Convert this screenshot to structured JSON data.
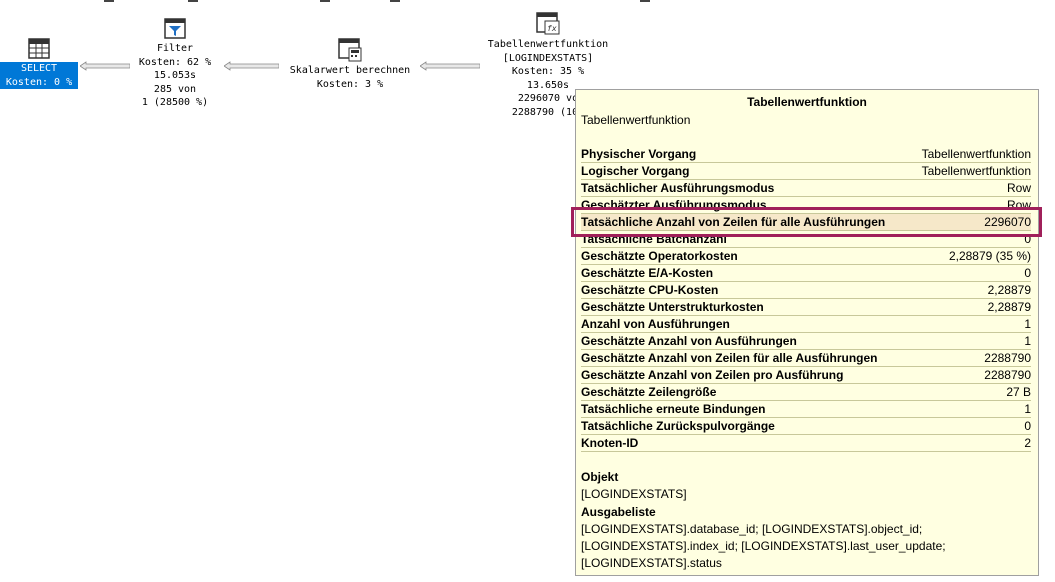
{
  "nodes": {
    "select": {
      "label": "SELECT",
      "cost": "Kosten: 0 %"
    },
    "filter": {
      "title": "Filter",
      "cost": "Kosten: 62 %",
      "time": "15.053s",
      "rows": "285 von",
      "est": "1 (28500 %)"
    },
    "scalar": {
      "title": "Skalarwert berechnen",
      "cost": "Kosten: 3 %"
    },
    "tvf": {
      "title": "Tabellenwertfunktion",
      "object": "[LOGINDEXSTATS]",
      "cost": "Kosten: 35 %",
      "time": "13.650s",
      "rows": "2296070 vo",
      "est": "2288790 (100"
    }
  },
  "tooltip": {
    "title": "Tabellenwertfunktion",
    "subtitle": "Tabellenwertfunktion",
    "properties": [
      {
        "key": "Physischer Vorgang",
        "value": "Tabellenwertfunktion"
      },
      {
        "key": "Logischer Vorgang",
        "value": "Tabellenwertfunktion"
      },
      {
        "key": "Tatsächlicher Ausführungsmodus",
        "value": "Row"
      },
      {
        "key": "Geschätzter Ausführungsmodus",
        "value": "Row"
      },
      {
        "key": "Tatsächliche Anzahl von Zeilen für alle Ausführungen",
        "value": "2296070"
      },
      {
        "key": "Tatsächliche Batchanzahl",
        "value": "0"
      },
      {
        "key": "Geschätzte Operatorkosten",
        "value": "2,28879 (35 %)"
      },
      {
        "key": "Geschätzte E/A-Kosten",
        "value": "0"
      },
      {
        "key": "Geschätzte CPU-Kosten",
        "value": "2,28879"
      },
      {
        "key": "Geschätzte Unterstrukturkosten",
        "value": "2,28879"
      },
      {
        "key": "Anzahl von Ausführungen",
        "value": "1"
      },
      {
        "key": "Geschätzte Anzahl von Ausführungen",
        "value": "1"
      },
      {
        "key": "Geschätzte Anzahl von Zeilen für alle Ausführungen",
        "value": "2288790"
      },
      {
        "key": "Geschätzte Anzahl von Zeilen pro Ausführung",
        "value": "2288790"
      },
      {
        "key": "Geschätzte Zeilengröße",
        "value": "27 B"
      },
      {
        "key": "Tatsächliche erneute Bindungen",
        "value": "1"
      },
      {
        "key": "Tatsächliche Zurückspulvorgänge",
        "value": "0"
      },
      {
        "key": "Knoten-ID",
        "value": "2"
      }
    ],
    "highlighted_index": 4,
    "object_heading": "Objekt",
    "object_value": "[LOGINDEXSTATS]",
    "output_heading": "Ausgabeliste",
    "output_lines": [
      "[LOGINDEXSTATS].database_id; [LOGINDEXSTATS].object_id;",
      "[LOGINDEXSTATS].index_id; [LOGINDEXSTATS].last_user_update;",
      "[LOGINDEXSTATS].status"
    ]
  },
  "colors": {
    "highlight_border": "#a0205a",
    "select_bg": "#0078d7",
    "tooltip_bg": "#ffffe1"
  }
}
